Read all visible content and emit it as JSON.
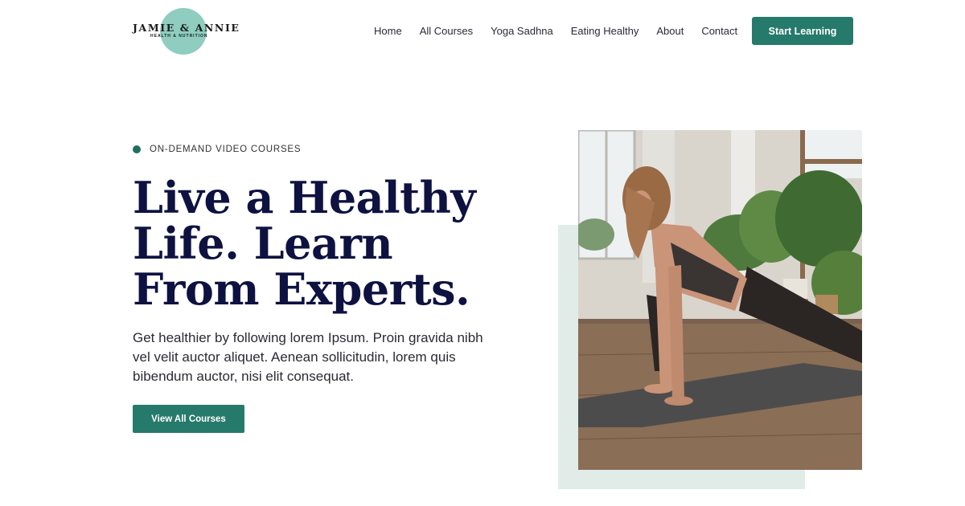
{
  "brand": {
    "name": "JAMIE & ANNIE",
    "tagline": "HEALTH & NUTRITION"
  },
  "nav": {
    "items": [
      "Home",
      "All Courses",
      "Yoga Sadhna",
      "Eating Healthy",
      "About",
      "Contact"
    ],
    "cta_label": "Start Learning"
  },
  "hero": {
    "eyebrow": "ON-DEMAND VIDEO COURSES",
    "headline": "Live a Healthy Life. Learn From Experts.",
    "body": "Get healthier by following lorem Ipsum. Proin gravida nibh vel velit auctor aliquet. Aenean sollicitudin, lorem quis bibendum auctor, nisi elit consequat.",
    "button_label": "View All Courses"
  },
  "colors": {
    "accent": "#267a6b",
    "logo_circle": "#8ecdbf",
    "heading": "#0e1240",
    "photo_backdrop": "#e1ece8"
  },
  "icons": {
    "play": "play-icon",
    "eyebrow": "dot-icon"
  }
}
